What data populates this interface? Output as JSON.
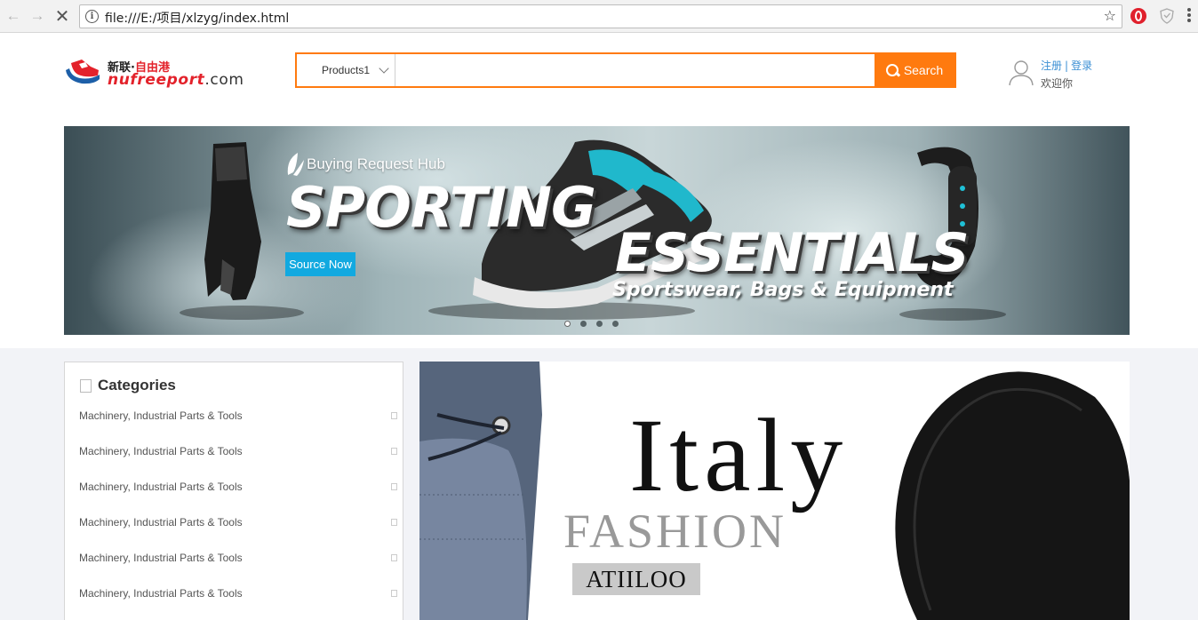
{
  "browser": {
    "url": "file:///E:/项目/xlzyg/index.html",
    "back_icon": "arrow-left-icon",
    "forward_icon": "arrow-right-icon",
    "stop_icon": "close-icon",
    "bookmark_icon": "star-icon"
  },
  "header": {
    "logo": {
      "cn_dark": "新联·",
      "cn_red": "自由港",
      "en_brand": "nufreeport",
      "en_domain": ".com"
    },
    "search": {
      "category": "Products1",
      "placeholder": "",
      "button_label": "Search"
    },
    "auth": {
      "register": "注册",
      "separator": "|",
      "login": "登录",
      "welcome": "欢迎你"
    }
  },
  "hero": {
    "hub_text": "Buying Request Hub",
    "title_line1": "SPORTING",
    "title_line2": "ESSENTIALS",
    "subtitle": "Sportswear, Bags & Equipment",
    "cta": "Source Now",
    "slides": 4,
    "active_slide": 1
  },
  "categories": {
    "title": "Categories",
    "items": [
      "Machinery, Industrial Parts & Tools",
      "Machinery, Industrial Parts & Tools",
      "Machinery, Industrial Parts & Tools",
      "Machinery, Industrial Parts & Tools",
      "Machinery, Industrial Parts & Tools",
      "Machinery, Industrial Parts & Tools"
    ]
  },
  "promo": {
    "headline": "Italy",
    "subheadline": "FASHION",
    "brand": "ATIILOO"
  },
  "colors": {
    "accent": "#ff7a0f",
    "link": "#3b8fd4",
    "logo_red": "#e3222b",
    "cta_blue": "#12a9e0"
  }
}
